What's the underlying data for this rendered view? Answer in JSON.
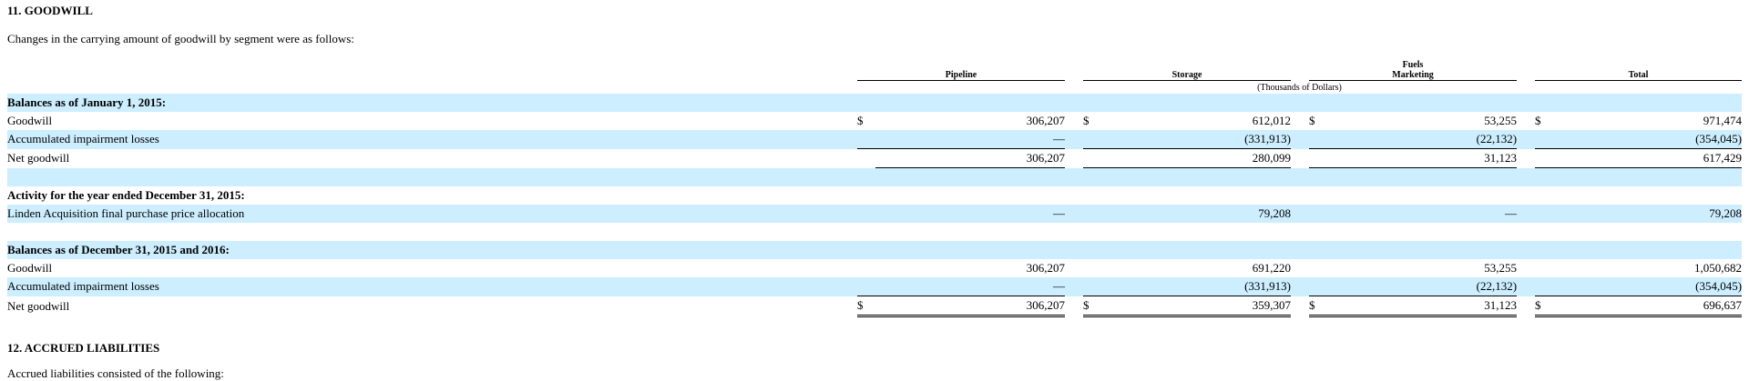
{
  "section11": {
    "heading": "11. GOODWILL",
    "intro": "Changes in the carrying amount of goodwill by segment were as follows:"
  },
  "table": {
    "columns": [
      "Pipeline",
      "Storage",
      "Fuels\nMarketing",
      "Total"
    ],
    "units": "(Thousands of Dollars)",
    "rows": [
      {
        "label": "Balances as of January 1, 2015:",
        "type": "section"
      },
      {
        "label": "Goodwill",
        "values": [
          "306,207",
          "612,012",
          "53,255",
          "971,474"
        ],
        "dollar": true
      },
      {
        "label": "Accumulated impairment losses",
        "values": [
          "—",
          "(331,913)",
          "(22,132)",
          "(354,045)"
        ]
      },
      {
        "label": "Net goodwill",
        "values": [
          "306,207",
          "280,099",
          "31,123",
          "617,429"
        ]
      },
      {
        "label": "Activity for the year ended December 31, 2015:",
        "type": "section"
      },
      {
        "label": "Linden Acquisition final purchase price allocation",
        "values": [
          "—",
          "79,208",
          "—",
          "79,208"
        ]
      },
      {
        "label": "Balances as of December 31, 2015 and 2016:",
        "type": "section"
      },
      {
        "label": "Goodwill",
        "values": [
          "306,207",
          "691,220",
          "53,255",
          "1,050,682"
        ]
      },
      {
        "label": "Accumulated impairment losses",
        "values": [
          "—",
          "(331,913)",
          "(22,132)",
          "(354,045)"
        ]
      },
      {
        "label": "Net goodwill",
        "values": [
          "306,207",
          "359,307",
          "31,123",
          "696,637"
        ],
        "dollar": true
      }
    ],
    "dollar_sign": "$"
  },
  "section12": {
    "heading": "12. ACCRUED LIABILITIES",
    "intro": "Accrued liabilities consisted of the following:"
  }
}
